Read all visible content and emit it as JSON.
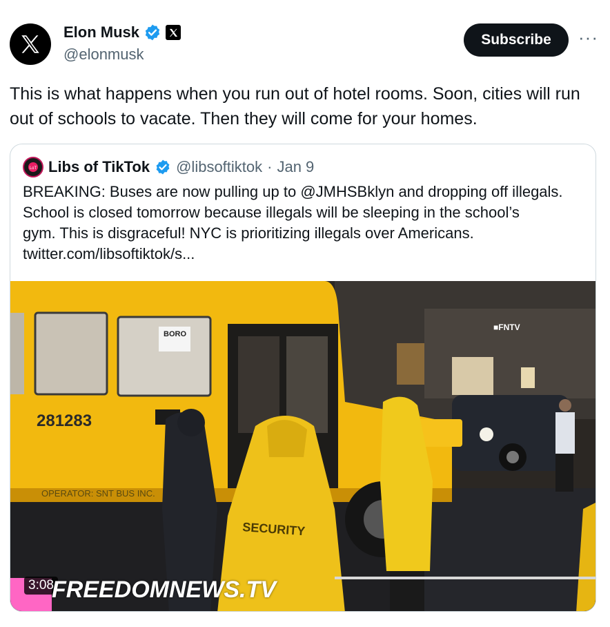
{
  "author": {
    "name": "Elon Musk",
    "handle": "@elonmusk",
    "verified": true,
    "avatar_icon": "x-logo-icon"
  },
  "actions": {
    "subscribe_label": "Subscribe",
    "more_label": "···"
  },
  "tweet": {
    "text": "This is what happens when you run out of hotel rooms. Soon, cities will run out of schools to vacate. Then they will come for your homes."
  },
  "quoted": {
    "name": "Libs of TikTok",
    "handle": "@libsoftiktok",
    "separator": "·",
    "date": "Jan 9",
    "lines": [
      "BREAKING: Buses are now pulling up to @JMHSBklyn and dropping off illegals.",
      "School is closed tomorrow because illegals will be sleeping in the school’s",
      "gym. This is disgraceful! NYC is prioritizing illegals over Americans.",
      "twitter.com/libsoftiktok/s..."
    ],
    "media": {
      "duration": "3:08",
      "watermark": "FREEDOMNEWS.TV",
      "corner_tag": "■FNTV",
      "bus_number": "281283",
      "bus_sign": "BORO",
      "operator_text": "OPERATOR: SNT BUS INC.",
      "security_text": "SECURITY"
    }
  },
  "colors": {
    "verified": "#1d9bf0",
    "subscribe_bg": "#0f1419",
    "muted": "#536471",
    "bus_yellow": "#f2b90f"
  }
}
